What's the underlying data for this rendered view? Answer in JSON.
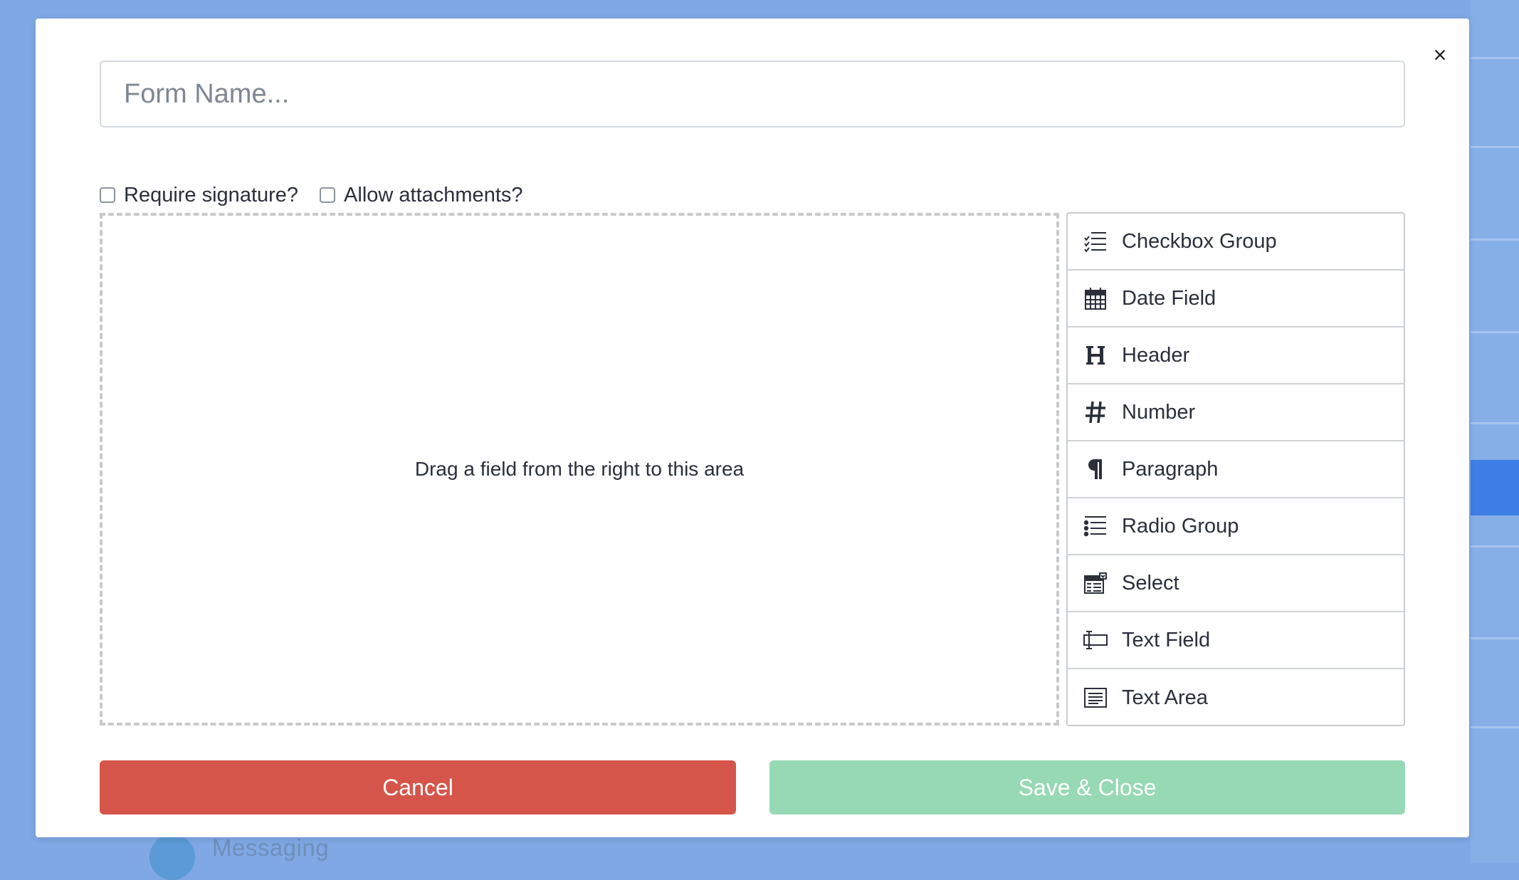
{
  "modal": {
    "close_symbol": "×",
    "form_name": {
      "value": "",
      "placeholder": "Form Name..."
    },
    "options": [
      {
        "label": "Require signature?",
        "checked": false
      },
      {
        "label": "Allow attachments?",
        "checked": false
      }
    ],
    "drop_zone_text": "Drag a field from the right to this area",
    "fields": [
      {
        "label": "Checkbox Group",
        "icon": "checkbox-list-icon"
      },
      {
        "label": "Date Field",
        "icon": "calendar-icon"
      },
      {
        "label": "Header",
        "icon": "header-icon"
      },
      {
        "label": "Number",
        "icon": "hash-icon"
      },
      {
        "label": "Paragraph",
        "icon": "paragraph-icon"
      },
      {
        "label": "Radio Group",
        "icon": "radio-list-icon"
      },
      {
        "label": "Select",
        "icon": "select-icon"
      },
      {
        "label": "Text Field",
        "icon": "text-field-icon"
      },
      {
        "label": "Text Area",
        "icon": "text-area-icon"
      }
    ],
    "cancel_label": "Cancel",
    "save_label": "Save & Close"
  },
  "background": {
    "nav_label": "Messaging",
    "nav_icon": "messaging-icon"
  },
  "colors": {
    "backdrop": "#7fa8e4",
    "cancel": "#d5554a",
    "save": "#96d9b4",
    "active_strip": "#3f7ee6"
  }
}
